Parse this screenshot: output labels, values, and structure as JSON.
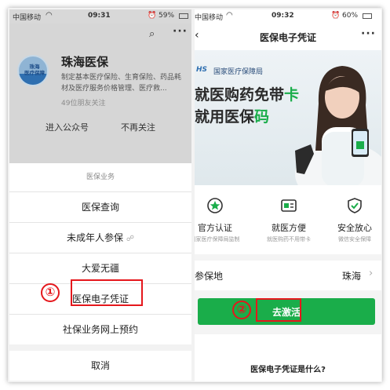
{
  "left": {
    "status": {
      "carrier": "中国移动",
      "time": "09:31",
      "battery": "59%"
    },
    "account": {
      "name": "珠海医保",
      "avatar_text": "珠海\n医疗保障",
      "description": "制定基本医疗保险、生育保险、药品耗材及医疗服务价格管理、医疗救...",
      "friends_following": "49位朋友关注",
      "enter_label": "进入公众号",
      "unfollow_label": "不再关注"
    },
    "menu": {
      "title": "医保业务",
      "items": [
        "医保查询",
        "未成年人参保",
        "大爱无疆",
        "医保电子凭证",
        "社保业务网上预约"
      ],
      "cancel": "取消"
    },
    "step_marker": "①"
  },
  "right": {
    "status": {
      "carrier": "中国移动",
      "time": "09:32",
      "battery": "60%"
    },
    "nav_title": "医保电子凭证",
    "banner": {
      "org_badge": "HS",
      "org_name": "国家医疗保障局",
      "line1_prefix": "就医购药免带",
      "line1_highlight": "卡",
      "line2_prefix": "就用医保",
      "line2_highlight": "码"
    },
    "features": [
      {
        "title": "官方认证",
        "subtitle": "国家医疗保障局监制",
        "icon": "star-badge-icon"
      },
      {
        "title": "就医方便",
        "subtitle": "就医购药不用带卡",
        "icon": "card-icon"
      },
      {
        "title": "安全放心",
        "subtitle": "微信安全保障",
        "icon": "shield-check-icon"
      }
    ],
    "insured_label": "参保地",
    "insured_value": "珠海",
    "activate_label": "去激活",
    "question_text": "医保电子凭证是什么?",
    "step_marker": "②"
  },
  "colors": {
    "wechat_green": "#1aad4a",
    "highlight_red": "#e5171c",
    "banner_text": "#2a2a2a"
  }
}
